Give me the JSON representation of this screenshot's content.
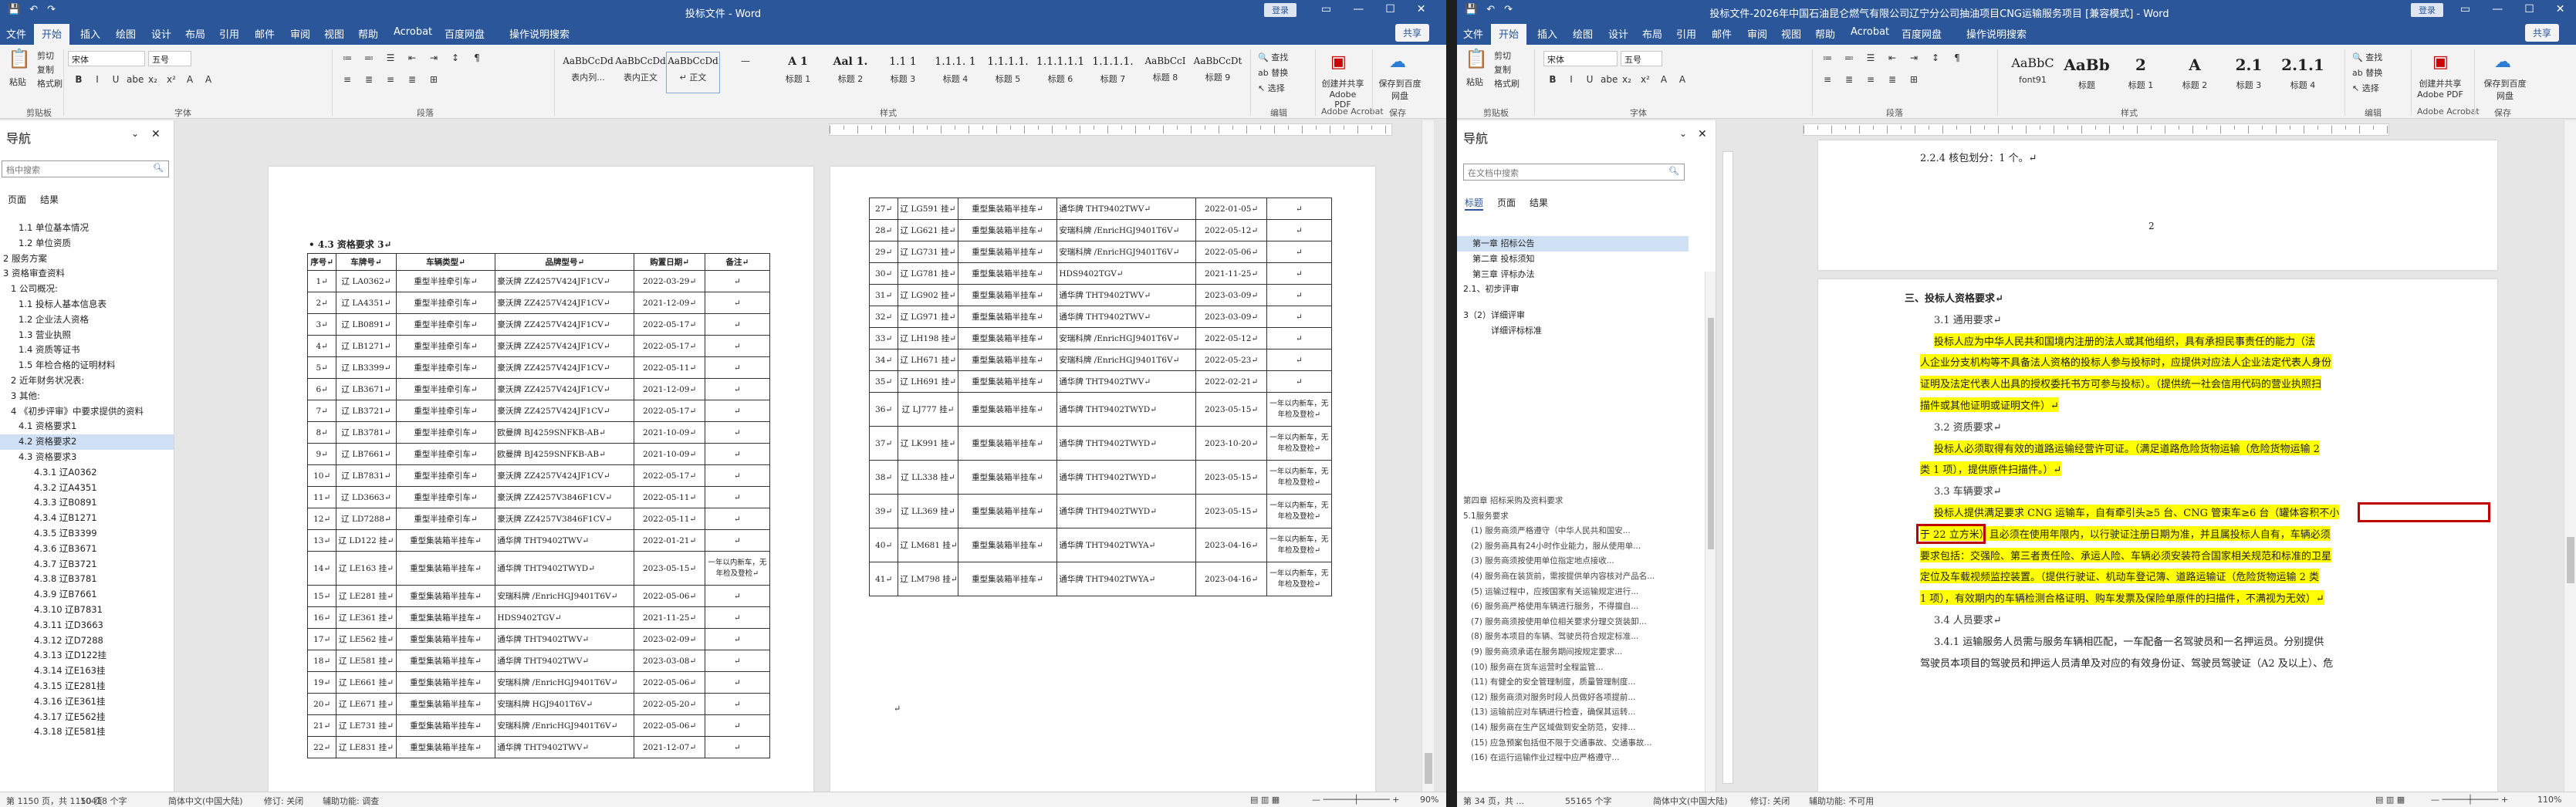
{
  "left": {
    "title": "投标文件 - Word",
    "login": "登录",
    "share": "共享",
    "menu": [
      "文件",
      "开始",
      "插入",
      "绘图",
      "设计",
      "布局",
      "引用",
      "邮件",
      "审阅",
      "视图",
      "帮助",
      "Acrobat",
      "百度网盘",
      "操作说明搜索"
    ],
    "ribbon": {
      "paste": "粘贴",
      "clip": [
        "剪切",
        "复制",
        "格式刷"
      ],
      "font_name": "宋体",
      "font_size": "五号",
      "fmt": [
        "B",
        "I",
        "U",
        "abe",
        "x₂",
        "x²",
        "A",
        "A"
      ],
      "styles": [
        {
          "pv": "AaBbCcDd",
          "nm": "表内列..."
        },
        {
          "pv": "AaBbCcDd",
          "nm": "表内正文"
        },
        {
          "pv": "AaBbCcDd",
          "nm": "↵ 正文"
        },
        {
          "pv": "—",
          "nm": ""
        },
        {
          "pv": "A 1",
          "nm": "标题 1"
        },
        {
          "pv": "Aal 1.",
          "nm": "标题 2"
        },
        {
          "pv": "1.1 1",
          "nm": "标题 3"
        },
        {
          "pv": "1.1.1. 1",
          "nm": "标题 4"
        },
        {
          "pv": "1.1.1.1.",
          "nm": "标题 5"
        },
        {
          "pv": "1.1.1.1.1",
          "nm": "标题 6"
        },
        {
          "pv": "1.1.1.1.",
          "nm": "标题 7"
        },
        {
          "pv": "AaBbCcI",
          "nm": "标题 8"
        },
        {
          "pv": "AaBbCcDt",
          "nm": "标题 9"
        }
      ],
      "edit": [
        "查找",
        "替换",
        "选择"
      ],
      "pdf": "创建并共享 Adobe PDF",
      "bdsave": "保存到百度网盘",
      "groups": [
        "剪贴板",
        "字体",
        "段落",
        "样式",
        "编辑",
        "Adobe Acrobat",
        "保存"
      ]
    },
    "nav": {
      "title": "导航",
      "search_placeholder": "档中搜索",
      "tabs": [
        "页面",
        "结果"
      ],
      "items": [
        "1.1 单位基本情况",
        "1.2 单位资质",
        "2 服务方案",
        "3 资格审查资料",
        "1 公司概况:",
        "1.1 投标人基本信息表",
        "1.2 企业法人资格",
        "1.3 营业执照",
        "1.4 资质等证书",
        "1.5 年检合格的证明材料",
        "2 近年财务状况表:",
        "3 其他:",
        "4 《初步评审》中要求提供的资料",
        "4.1 资格要求1",
        "4.2 资格要求2",
        "4.3 资格要求3",
        "4.3.1 辽A0362",
        "4.3.2 辽A4351",
        "4.3.3 辽B0891",
        "4.3.4 辽B1271",
        "4.3.5 辽B3399",
        "4.3.6 辽B3671",
        "4.3.7 辽B3721",
        "4.3.8 辽B3781",
        "4.3.9 辽B7661",
        "4.3.10 辽B7831",
        "4.3.11 辽D3663",
        "4.3.12 辽D7288",
        "4.3.13 辽D122挂",
        "4.3.14 辽E163挂",
        "4.3.15 辽E281挂",
        "4.3.16 辽E361挂",
        "4.3.17 辽E562挂",
        "4.3.18 辽E581挂"
      ]
    },
    "doc_heading": "• 4.3 资格要求 3↵",
    "table_header": [
      "序号↵",
      "车牌号↵",
      "车辆类型↵",
      "品牌型号↵",
      "购置日期↵",
      "备注↵"
    ],
    "rows1": [
      [
        "1↵",
        "辽 LA0362↵",
        "重型半挂牵引车↵",
        "豪沃牌 ZZ4257V424JF1CV↵",
        "2022-03-29↵",
        "↵"
      ],
      [
        "2↵",
        "辽 LA4351↵",
        "重型半挂牵引车↵",
        "豪沃牌 ZZ4257V424JF1CV↵",
        "2021-12-09↵",
        "↵"
      ],
      [
        "3↵",
        "辽 LB0891↵",
        "重型半挂牵引车↵",
        "豪沃牌 ZZ4257V424JF1CV↵",
        "2022-05-17↵",
        "↵"
      ],
      [
        "4↵",
        "辽 LB1271↵",
        "重型半挂牵引车↵",
        "豪沃牌 ZZ4257V424JF1CV↵",
        "2022-05-17↵",
        "↵"
      ],
      [
        "5↵",
        "辽 LB3399↵",
        "重型半挂牵引车↵",
        "豪沃牌 ZZ4257V424JF1CV↵",
        "2022-05-11↵",
        "↵"
      ],
      [
        "6↵",
        "辽 LB3671↵",
        "重型半挂牵引车↵",
        "豪沃牌 ZZ4257V424JF1CV↵",
        "2021-12-09↵",
        "↵"
      ],
      [
        "7↵",
        "辽 LB3721↵",
        "重型半挂牵引车↵",
        "豪沃牌 ZZ4257V424JF1CV↵",
        "2022-05-17↵",
        "↵"
      ],
      [
        "8↵",
        "辽 LB3781↵",
        "重型半挂牵引车↵",
        "欧曼牌 BJ4259SNFKB-AB↵",
        "2021-10-09↵",
        "↵"
      ],
      [
        "9↵",
        "辽 LB7661↵",
        "重型半挂牵引车↵",
        "欧曼牌 BJ4259SNFKB-AB↵",
        "2021-10-09↵",
        "↵"
      ],
      [
        "10↵",
        "辽 LB7831↵",
        "重型半挂牵引车↵",
        "豪沃牌 ZZ4257V424JF1CV↵",
        "2022-05-17↵",
        "↵"
      ],
      [
        "11↵",
        "辽 LD3663↵",
        "重型半挂牵引车↵",
        "豪沃牌 ZZ4257V3846F1CV↵",
        "2022-05-11↵",
        "↵"
      ],
      [
        "12↵",
        "辽 LD7288↵",
        "重型半挂牵引车↵",
        "豪沃牌 ZZ4257V3846F1CV↵",
        "2022-05-11↵",
        "↵"
      ],
      [
        "13↵",
        "辽 LD122 挂↵",
        "重型集装箱半挂车↵",
        "通华牌 THT9402TWV↵",
        "2022-01-21↵",
        "↵"
      ],
      [
        "14↵",
        "辽 LE163 挂↵",
        "重型集装箱半挂车↵",
        "通华牌 THT9402TWYD↵",
        "2023-05-15↵",
        "一年以内新车，无年检及登检↵"
      ],
      [
        "15↵",
        "辽 LE281 挂↵",
        "重型集装箱半挂车↵",
        "安瑞科牌 /EnricHGJ9401T6V↵",
        "2022-05-06↵",
        "↵"
      ],
      [
        "16↵",
        "辽 LE361 挂↵",
        "重型集装箱半挂车↵",
        "HDS9402TGV↵",
        "2021-11-25↵",
        "↵"
      ],
      [
        "17↵",
        "辽 LE562 挂↵",
        "重型集装箱半挂车↵",
        "通华牌 THT9402TWV↵",
        "2023-02-09↵",
        "↵"
      ],
      [
        "18↵",
        "辽 LE581 挂↵",
        "重型集装箱半挂车↵",
        "通华牌 THT9402TWV↵",
        "2023-03-08↵",
        "↵"
      ],
      [
        "19↵",
        "辽 LE661 挂↵",
        "重型集装箱半挂车↵",
        "安瑞科牌 /EnricHGJ9401T6V↵",
        "2022-05-06↵",
        "↵"
      ],
      [
        "20↵",
        "辽 LE671 挂↵",
        "重型集装箱半挂车↵",
        "安瑞科牌 HGJ9401T6V↵",
        "2022-05-20↵",
        "↵"
      ],
      [
        "21↵",
        "辽 LE731 挂↵",
        "重型集装箱半挂车↵",
        "安瑞科牌 /EnricHGJ9401T6V↵",
        "2022-05-06↵",
        "↵"
      ],
      [
        "22↵",
        "辽 LE831 挂↵",
        "重型集装箱半挂车↵",
        "通华牌 THT9402TWV↵",
        "2021-12-07↵",
        "↵"
      ]
    ],
    "rows2": [
      [
        "27↵",
        "辽 LG591 挂↵",
        "重型集装箱半挂车↵",
        "通华牌 THT9402TWV↵",
        "2022-01-05↵",
        "↵"
      ],
      [
        "28↵",
        "辽 LG621 挂↵",
        "重型集装箱半挂车↵",
        "安瑞科牌 /EnricHGJ9401T6V↵",
        "2022-05-12↵",
        "↵"
      ],
      [
        "29↵",
        "辽 LG731 挂↵",
        "重型集装箱半挂车↵",
        "安瑞科牌 /EnricHGJ9401T6V↵",
        "2022-05-06↵",
        "↵"
      ],
      [
        "30↵",
        "辽 LG781 挂↵",
        "重型集装箱半挂车↵",
        "HDS9402TGV↵",
        "2021-11-25↵",
        "↵"
      ],
      [
        "31↵",
        "辽 LG902 挂↵",
        "重型集装箱半挂车↵",
        "通华牌 THT9402TWV↵",
        "2023-03-09↵",
        "↵"
      ],
      [
        "32↵",
        "辽 LG971 挂↵",
        "重型集装箱半挂车↵",
        "通华牌 THT9402TWV↵",
        "2023-03-09↵",
        "↵"
      ],
      [
        "33↵",
        "辽 LH198 挂↵",
        "重型集装箱半挂车↵",
        "安瑞科牌 /EnricHGJ9401T6V↵",
        "2022-05-12↵",
        "↵"
      ],
      [
        "34↵",
        "辽 LH671 挂↵",
        "重型集装箱半挂车↵",
        "安瑞科牌 /EnricHGJ9401T6V↵",
        "2022-05-23↵",
        "↵"
      ],
      [
        "35↵",
        "辽 LH691 挂↵",
        "重型集装箱半挂车↵",
        "通华牌 THT9402TWV↵",
        "2022-02-21↵",
        "↵"
      ],
      [
        "36↵",
        "辽 LJ777 挂↵",
        "重型集装箱半挂车↵",
        "通华牌 THT9402TWYD↵",
        "2023-05-15↵",
        "一年以内新车，无年检及登检↵"
      ],
      [
        "37↵",
        "辽 LK991 挂↵",
        "重型集装箱半挂车↵",
        "通华牌 THT9402TWYD↵",
        "2023-10-20↵",
        "一年以内新车，无年检及登检↵"
      ],
      [
        "38↵",
        "辽 LL338 挂↵",
        "重型集装箱半挂车↵",
        "通华牌 THT9402TWYD↵",
        "2023-05-15↵",
        "一年以内新车，无年检及登检↵"
      ],
      [
        "39↵",
        "辽 LL369 挂↵",
        "重型集装箱半挂车↵",
        "通华牌 THT9402TWYD↵",
        "2023-05-15↵",
        "一年以内新车，无年检及登检↵"
      ],
      [
        "40↵",
        "辽 LM681 挂↵",
        "重型集装箱半挂车↵",
        "通华牌 THT9402TWYA↵",
        "2023-04-16↵",
        "一年以内新车，无年检及登检↵"
      ],
      [
        "41↵",
        "辽 LM798 挂↵",
        "重型集装箱半挂车↵",
        "通华牌 THT9402TWYA↵",
        "2023-04-16↵",
        "一年以内新车，无年检及登检↵"
      ]
    ],
    "status": {
      "page": "第 1150 页，共 1150 页",
      "words": "10418 个字",
      "lang": "简体中文(中国大陆)",
      "track": "修订: 关闭",
      "acc": "辅助功能: 调查",
      "zoom": "90%"
    }
  },
  "right": {
    "title": "投标文件-2026年中国石油昆仑燃气有限公司辽宁分公司抽油项目CNG运输服务项目 [兼容模式] - Word",
    "login": "登录",
    "share": "共享",
    "menu": [
      "文件",
      "开始",
      "插入",
      "绘图",
      "设计",
      "布局",
      "引用",
      "邮件",
      "审阅",
      "视图",
      "帮助",
      "Acrobat",
      "百度网盘",
      "操作说明搜索"
    ],
    "ribbon": {
      "paste": "粘贴",
      "clip": [
        "剪切",
        "复制",
        "格式刷"
      ],
      "font_name": "宋体",
      "font_size": "五号",
      "styles": [
        {
          "pv": "AaBbC",
          "nm": "font91"
        },
        {
          "pv": "AaBb",
          "nm": "标题"
        },
        {
          "pv": "2",
          "nm": "标题 1"
        },
        {
          "pv": "A",
          "nm": "标题 2"
        },
        {
          "pv": "2.1",
          "nm": "标题 3"
        },
        {
          "pv": "2.1.1",
          "nm": "标题 4"
        }
      ],
      "edit": [
        "查找",
        "替换",
        "选择"
      ],
      "pdf": "创建并共享 Adobe PDF",
      "bdsave": "保存到百度网盘",
      "groups": [
        "剪贴板",
        "字体",
        "段落",
        "样式",
        "编辑",
        "Adobe Acrobat",
        "保存"
      ]
    },
    "nav": {
      "title": "导航",
      "search_placeholder": "在文档中搜索",
      "tabs": [
        "标题",
        "页面",
        "结果"
      ],
      "items_top": [
        "第一章 招标公告",
        "第二章 投标须知",
        "第三章 评标办法",
        "2.1、初步评审",
        "3（2）详细评审",
        "详细评标标准"
      ],
      "items_bottom": [
        "第四章 招标采购及资料要求",
        "5.1服务要求",
        "(1) 服务商须严格遵守（中华人民共和国安...",
        "(2) 服务商具有24小时作业能力，服从使用单...",
        "(3) 服务商须按使用单位指定地点接收...",
        "(4) 服务商在装货前，需按提供单内容核对产品名...",
        "(5) 运输过程中，应按国家有关运输规定进行...",
        "(6) 服务商严格使用车辆进行服务，不得擅自...",
        "(7) 服务商须按使用单位相关要求分理交货装卸...",
        "(8) 服务本项目的车辆、驾驶员符合规定标准...",
        "(9) 服务商须承诺在服务期间按规定要求...",
        "(10) 服务商在货车运营时全程监管...",
        "(11) 有健全的安全管理制度，质量管理制度...",
        "(12) 服务商须对服务时段人员做好各项提前...",
        "(13) 运输前应对车辆进行检查，确保其运转...",
        "(14) 服务商在生产区域做到安全防范，安排...",
        "(15) 应急预案包括但不限于交通事故、交通事故...",
        "(16) 在运行运输作业过程中应严格遵守..."
      ]
    },
    "page1": {
      "line": "2.2.4 核包划分：1 个。↵",
      "pagenum": "2"
    },
    "page2": [
      "三、投标人资格要求↵",
      "3.1 通用要求↵",
      "投标人应为中华人民共和国境内注册的法人或其他组织，具有承担民事责任的能力（法",
      "人企业分支机构等不具备法人资格的投标人参与投标时，应提供对应法人企业法定代表人身份",
      "证明及法定代表人出具的授权委托书方可参与投标）。（提供统一社会信用代码的营业执照扫",
      "描件或其他证明或证明文件）↵",
      "3.2 资质要求↵",
      "投标人必须取得有效的道路运输经营许可证。（满足道路危险货物运输（危险货物运输 2",
      "类 1 项），提供原件扫描件。）↵",
      "3.3 车辆要求↵",
      "投标人提供满足要求 CNG 运输车，自有牵引头≥5 台、CNG 管束车≥6 台（罐体容积不小",
      "于 22 立方米）且必须在使用年限内，以行驶证注册日期为准，并且属投标人自有，车辆必须",
      "要求包括：交强险、第三者责任险、承运人险、车辆必须安装符合国家相关规范和标准的卫星",
      "定位及车载视频监控装置。（提供行驶证、机动车登记簿、道路运输证（危险货物运输 2 类",
      "1 项），有效期内的车辆检测合格证明、购车发票及保险单原件的扫描件，不满视为无效）↵",
      "3.4 人员要求↵",
      "3.4.1 运输服务人员需与服务车辆相匹配，一车配备一名驾驶员和一名押运员。分别提供",
      "驾驶员本项目的驾驶员和押运人员清单及对应的有效身份证、驾驶员驾驶证（A2 及以上）、危"
    ],
    "status": {
      "page": "第 34 页，共 ...",
      "words": "55165 个字",
      "lang": "简体中文(中国大陆)",
      "track": "修订: 关闭",
      "acc": "辅助功能: 不可用",
      "zoom": "110%"
    }
  }
}
